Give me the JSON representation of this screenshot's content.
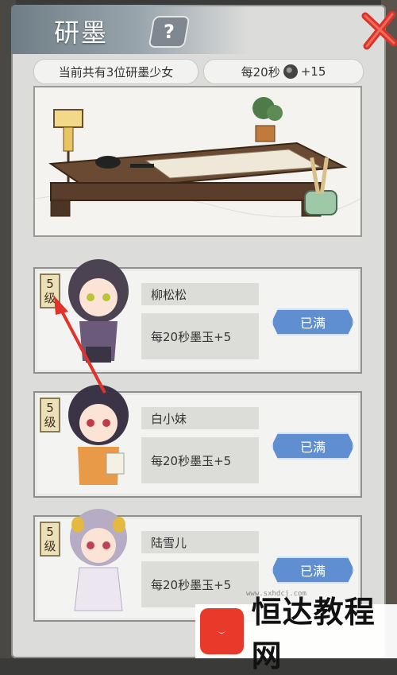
{
  "header": {
    "title": "研墨",
    "help_label": "?"
  },
  "stats": {
    "count_text": "当前共有3位研墨少女",
    "rate_prefix": "每20秒",
    "rate_suffix": "+15"
  },
  "girls": [
    {
      "level_num": "5",
      "level_unit": "级",
      "name": "柳松松",
      "rate": "每20秒墨玉+5",
      "button": "已满"
    },
    {
      "level_num": "5",
      "level_unit": "级",
      "name": "白小妹",
      "rate": "每20秒墨玉+5",
      "button": "已满"
    },
    {
      "level_num": "5",
      "level_unit": "级",
      "name": "陆雪儿",
      "rate": "每20秒墨玉+5",
      "button": "已满"
    }
  ],
  "watermark": {
    "brand": "恒达教程网",
    "url": "www.sxhdcj.com"
  },
  "colors": {
    "button_blue": "#5f8fd0",
    "arrow_red": "#e0332a"
  }
}
